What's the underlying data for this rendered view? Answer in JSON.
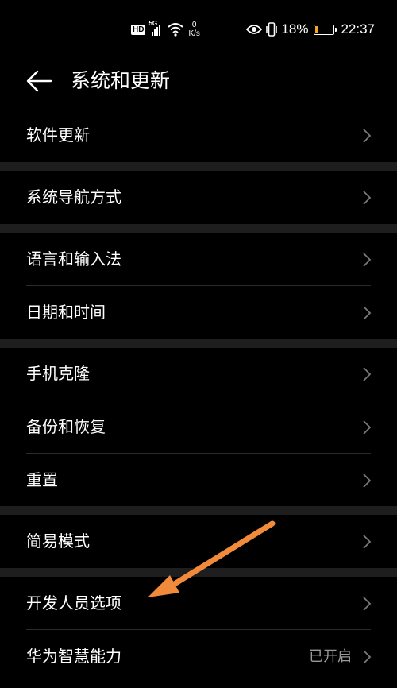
{
  "status_bar": {
    "hd": "HD",
    "network": "5G",
    "speed_value": "0",
    "speed_unit": "K/s",
    "battery_percent": "18%",
    "battery_level": 0.18,
    "battery_color": "#f5a623",
    "time": "22:37",
    "icons": [
      "signal-icon",
      "wifi-icon",
      "eye-icon",
      "vibrate-icon",
      "battery-icon"
    ]
  },
  "header": {
    "title": "系统和更新",
    "back_icon": "back-arrow-icon"
  },
  "groups": [
    {
      "items": [
        {
          "label": "软件更新"
        }
      ]
    },
    {
      "items": [
        {
          "label": "系统导航方式"
        }
      ]
    },
    {
      "items": [
        {
          "label": "语言和输入法"
        },
        {
          "label": "日期和时间"
        }
      ]
    },
    {
      "items": [
        {
          "label": "手机克隆"
        },
        {
          "label": "备份和恢复"
        },
        {
          "label": "重置"
        }
      ]
    },
    {
      "items": [
        {
          "label": "简易模式"
        }
      ]
    },
    {
      "items": [
        {
          "label": "开发人员选项"
        },
        {
          "label": "华为智慧能力",
          "status": "已开启"
        }
      ]
    }
  ],
  "annotation": {
    "arrow_color": "#f28a3c",
    "arrow_icon": "annotation-arrow-icon"
  }
}
